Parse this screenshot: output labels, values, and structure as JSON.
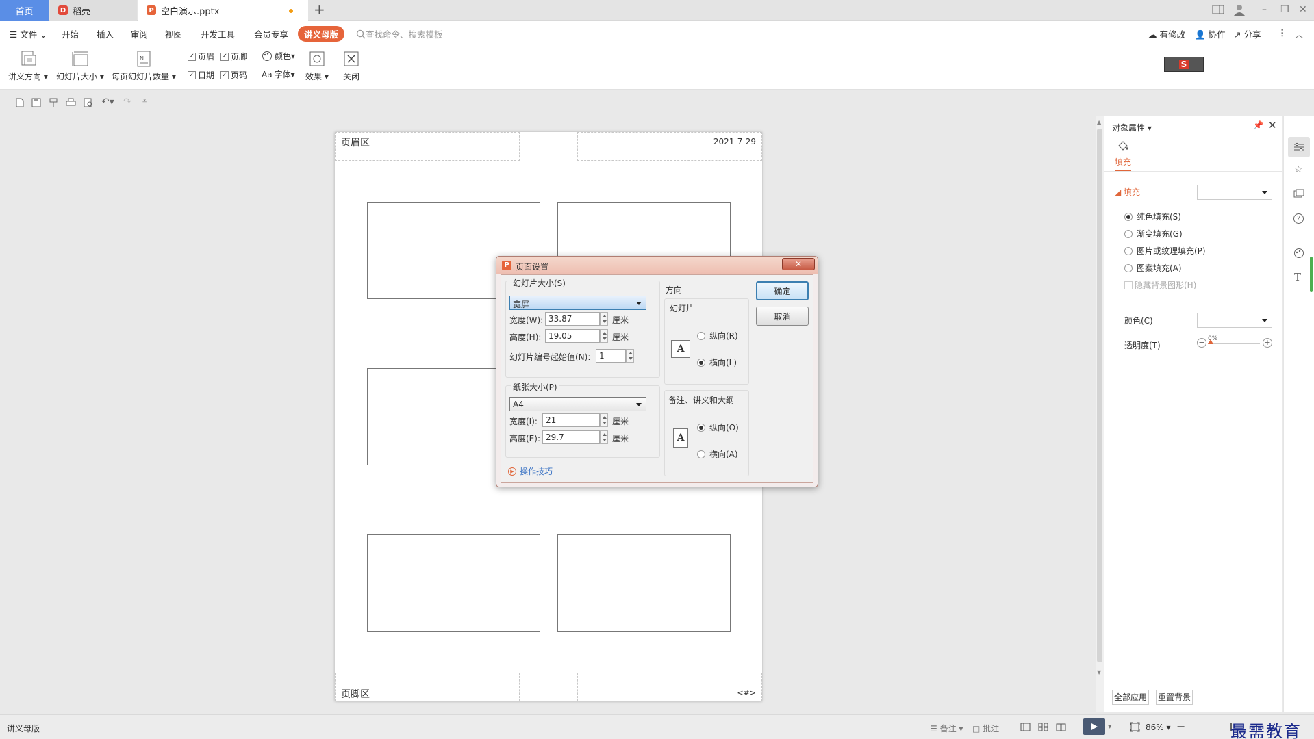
{
  "tabs": {
    "home": "首页",
    "daoke": "稻壳",
    "doc": "空白演示.pptx",
    "new": "+"
  },
  "window": {
    "minimize": "–",
    "restore": "❐",
    "close": "✕"
  },
  "menu": {
    "file": "文件",
    "items": [
      "开始",
      "插入",
      "审阅",
      "视图",
      "开发工具",
      "会员专享"
    ],
    "active": "讲义母版",
    "search": "查找命令、搜索模板",
    "right": {
      "changes": "有修改",
      "collab": "协作",
      "share": "分享"
    }
  },
  "ribbon": {
    "orientation": "讲义方向",
    "slide_size": "幻灯片大小",
    "per_page": "每页幻灯片数量",
    "checks": {
      "header": "页眉",
      "footer": "页脚",
      "date": "日期",
      "page_no": "页码"
    },
    "colors": "颜色",
    "fonts": "字体",
    "fonts_prefix": "Aa",
    "effects": "效果",
    "close": "关闭"
  },
  "page": {
    "header": "页眉区",
    "date": "2021-7-29",
    "footer": "页脚区",
    "page_no": "<#>"
  },
  "dialog": {
    "title": "页面设置",
    "slide_size_group": "幻灯片大小(S)",
    "slide_size_value": "宽屏",
    "width_label": "宽度(W):",
    "width_value": "33.87",
    "height_label": "高度(H):",
    "height_value": "19.05",
    "unit": "厘米",
    "start_label": "幻灯片编号起始值(N):",
    "start_value": "1",
    "paper_group": "纸张大小(P)",
    "paper_value": "A4",
    "paper_width_label": "宽度(I):",
    "paper_width_value": "21",
    "paper_height_label": "高度(E):",
    "paper_height_value": "29.7",
    "tips": "操作技巧",
    "orientation": "方向",
    "slides_group": "幻灯片",
    "portrait_r": "纵向(R)",
    "landscape_l": "横向(L)",
    "notes_group": "备注、讲义和大纲",
    "portrait_o": "纵向(O)",
    "landscape_a": "横向(A)",
    "ok": "确定",
    "cancel": "取消"
  },
  "panel": {
    "title": "对象属性",
    "tab_fill": "填充",
    "section": "填充",
    "options": [
      "纯色填充(S)",
      "渐变填充(G)",
      "图片或纹理填充(P)",
      "图案填充(A)"
    ],
    "hide_bg": "隐藏背景图形(H)",
    "color": "颜色(C)",
    "transparency": "透明度(T)",
    "transparency_value": "0%",
    "apply_all": "全部应用",
    "reset_bg": "重置背景"
  },
  "status": {
    "mode": "讲义母版",
    "notes": "备注",
    "comments": "批注",
    "zoom": "86%",
    "watermark": "最需教育"
  },
  "colors": {
    "accent": "#e6643a",
    "home_tab": "#5a8ee6",
    "link": "#3b73c4",
    "panel_accent": "#e0663a"
  }
}
